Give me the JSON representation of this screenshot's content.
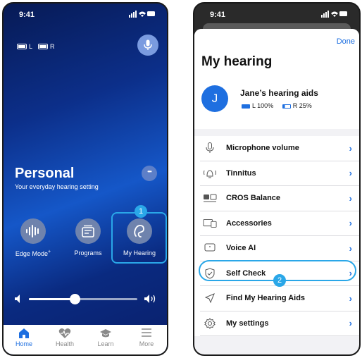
{
  "left_screen": {
    "status_time": "9:41",
    "battery_left_label": "L",
    "battery_right_label": "R",
    "program_title": "Personal",
    "program_subtitle": "Your everyday hearing setting",
    "more_symbol": "•••",
    "actions": [
      {
        "label": "Edge Mode",
        "superscript": "+",
        "icon": "edge-mode-icon"
      },
      {
        "label": "Programs",
        "icon": "programs-icon"
      },
      {
        "label": "My Hearing",
        "icon": "hearing-icon"
      }
    ],
    "highlight_badge": "1",
    "volume_level": 0.42,
    "tabs": [
      {
        "label": "Home",
        "icon": "home-icon",
        "active": true
      },
      {
        "label": "Health",
        "icon": "heart-icon",
        "active": false
      },
      {
        "label": "Learn",
        "icon": "graduation-cap-icon",
        "active": false
      },
      {
        "label": "More",
        "icon": "menu-icon",
        "active": false
      }
    ]
  },
  "right_screen": {
    "status_time": "9:41",
    "done_label": "Done",
    "title": "My hearing",
    "avatar_letter": "J",
    "aid_name": "Jane’s hearing aids",
    "battery_left": "L 100%",
    "battery_right": "R 25%",
    "menu": [
      {
        "label": "Microphone volume",
        "icon": "microphone-icon"
      },
      {
        "label": "Tinnitus",
        "icon": "tinnitus-icon"
      },
      {
        "label": "CROS Balance",
        "icon": "cros-balance-icon"
      },
      {
        "label": "Accessories",
        "icon": "accessories-icon"
      },
      {
        "label": "Voice AI",
        "icon": "voice-ai-icon"
      },
      {
        "label": "Self Check",
        "icon": "shield-check-icon"
      },
      {
        "label": "Find My Hearing Aids",
        "icon": "location-arrow-icon"
      },
      {
        "label": "My settings",
        "icon": "gear-icon"
      }
    ],
    "highlight_badge": "2"
  },
  "colors": {
    "accent": "#1e6fe0",
    "highlight": "#2aa7e8",
    "battery_full": "#1e6fe0",
    "battery_low": "#1e6fe0"
  }
}
